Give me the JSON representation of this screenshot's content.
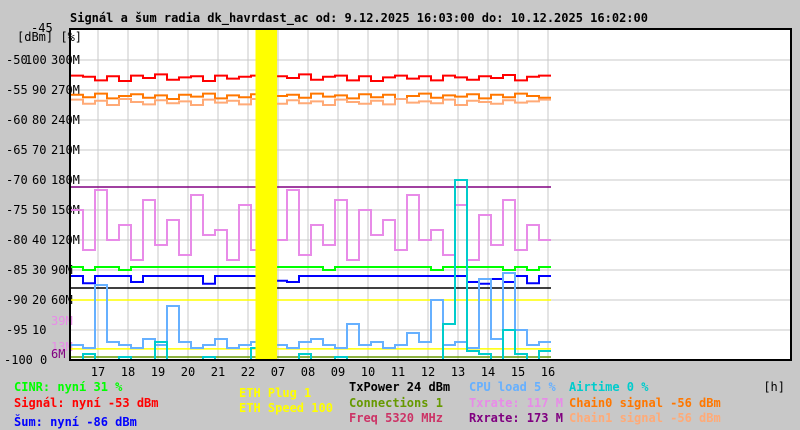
{
  "chart_data": {
    "type": "line",
    "title": "Signál a šum radia dk_havrdast_ac od: 9.12.2025 16:03:00 do: 10.12.2025 16:02:00",
    "xlabel": "[h]",
    "ylabel": "[dBm] [%]",
    "xlim": [
      0,
      24
    ],
    "ylim_dbm": [
      -100,
      -45
    ],
    "ylim_pct": [
      0,
      110
    ],
    "ylim_rate_M": [
      0,
      330
    ],
    "grid": true,
    "y_ticks_dbm": [
      "-45",
      "-50",
      "-55",
      "-60",
      "-65",
      "-70",
      "-75",
      "-80",
      "-85",
      "-90",
      "-95",
      "-100"
    ],
    "y_ticks_pct": [
      "100",
      "90",
      "80",
      "70",
      "60",
      "50",
      "40",
      "30",
      "20",
      "10",
      "0"
    ],
    "y_ticks_rate": [
      "300M",
      "270M",
      "240M",
      "210M",
      "180M",
      "150M",
      "120M",
      "90M",
      "60M"
    ],
    "rate_marks": [
      {
        "label": "39M",
        "value": 39,
        "color": "#e88be8"
      },
      {
        "label": "13M",
        "value": 13,
        "color": "#e88be8"
      },
      {
        "label": "6M",
        "value": 6,
        "color": "#800080"
      }
    ],
    "x_ticks": [
      "17",
      "18",
      "19",
      "20",
      "21",
      "22",
      "07",
      "08",
      "09",
      "10",
      "11",
      "12",
      "13",
      "14",
      "15",
      "16"
    ],
    "x_tick_start": 0.9,
    "sample_step_h": 0.4,
    "outage_h": [
      6.15,
      6.87
    ],
    "outage_color": "#ffff00",
    "series": [
      {
        "name": "Signál",
        "unit": "dBm",
        "color": "#ff0000",
        "values": [
          -52.6,
          -52.8,
          -53.4,
          -52.7,
          -53.5,
          -52.6,
          -53.0,
          -52.4,
          -53.3,
          -52.9,
          -52.7,
          -53.5,
          -52.6,
          -53.1,
          -52.8,
          -52.6,
          -53.4,
          -52.7,
          -53.0,
          -52.4,
          -53.3,
          -52.8,
          -52.6,
          -53.4,
          -52.7,
          -53.5,
          -52.9,
          -52.6,
          -53.1,
          -52.7,
          -53.4,
          -52.6,
          -52.9,
          -53.3,
          -52.7,
          -53.0,
          -52.5,
          -53.4,
          -52.8,
          -52.6
        ]
      },
      {
        "name": "Chain0 signal",
        "unit": "dBm",
        "color": "#ff7700",
        "values": [
          -55.8,
          -56.2,
          -55.6,
          -56.4,
          -56.0,
          -55.7,
          -56.3,
          -55.9,
          -56.5,
          -55.8,
          -56.1,
          -55.6,
          -56.4,
          -55.9,
          -56.2,
          -55.7,
          -56.5,
          -56.0,
          -55.8,
          -56.3,
          -55.6,
          -56.1,
          -55.9,
          -56.4,
          -55.7,
          -56.2,
          -55.8,
          -56.5,
          -56.0,
          -55.6,
          -56.3,
          -55.9,
          -56.1,
          -55.7,
          -56.4,
          -55.8,
          -56.2,
          -55.6,
          -56.0,
          -56.3
        ]
      },
      {
        "name": "Chain1 signal",
        "unit": "dBm",
        "color": "#ffaa77",
        "values": [
          -56.6,
          -57.3,
          -56.8,
          -57.5,
          -56.5,
          -57.0,
          -57.4,
          -56.7,
          -57.2,
          -56.9,
          -57.5,
          -56.6,
          -57.1,
          -56.8,
          -57.4,
          -56.5,
          -57.0,
          -57.3,
          -56.7,
          -57.2,
          -56.9,
          -57.5,
          -56.6,
          -57.0,
          -57.3,
          -56.8,
          -57.4,
          -56.5,
          -57.1,
          -56.9,
          -57.2,
          -56.6,
          -57.5,
          -56.8,
          -57.0,
          -57.3,
          -56.7,
          -57.1,
          -56.9,
          -56.6
        ]
      },
      {
        "name": "Txrate",
        "unit": "M",
        "color": "#e88be8",
        "values": [
          150,
          110,
          170,
          120,
          135,
          100,
          160,
          115,
          140,
          105,
          165,
          125,
          130,
          100,
          155,
          110,
          145,
          120,
          170,
          105,
          135,
          115,
          160,
          100,
          150,
          125,
          140,
          110,
          165,
          120,
          130,
          105,
          155,
          100,
          145,
          115,
          160,
          110,
          135,
          120
        ]
      },
      {
        "name": "Rxrate",
        "unit": "M",
        "color": "#800080",
        "values": [
          173,
          173,
          173,
          173,
          173,
          173,
          173,
          173,
          173,
          173,
          173,
          173,
          173,
          173,
          173,
          173,
          173,
          173,
          173,
          173,
          173,
          173,
          173,
          173,
          173,
          173,
          173,
          173,
          173,
          173,
          173,
          173,
          173,
          173,
          173,
          173,
          173,
          173,
          173,
          173
        ]
      },
      {
        "name": "CINR",
        "unit": "%",
        "color": "#00ff00",
        "values": [
          31,
          30,
          31,
          31,
          30,
          31,
          31,
          31,
          31,
          31,
          31,
          31,
          31,
          31,
          31,
          31,
          30,
          31,
          31,
          31,
          31,
          30,
          31,
          31,
          31,
          31,
          31,
          31,
          31,
          31,
          30,
          31,
          31,
          31,
          31,
          31,
          30,
          31,
          30,
          31
        ]
      },
      {
        "name": "Šum",
        "unit": "dBm",
        "color": "#0000ff",
        "values": [
          -86.0,
          -87.2,
          -86.0,
          -86.0,
          -86.0,
          -87.0,
          -86.0,
          -86.0,
          -86.0,
          -86.0,
          -86.0,
          -87.3,
          -86.0,
          -86.0,
          -86.0,
          -86.0,
          -86.0,
          -86.8,
          -87.0,
          -86.0,
          -86.0,
          -86.0,
          -86.0,
          -86.0,
          -86.0,
          -86.0,
          -86.0,
          -86.0,
          -86.0,
          -86.0,
          -86.0,
          -86.0,
          -86.0,
          -87.0,
          -87.3,
          -86.5,
          -87.0,
          -86.0,
          -87.2,
          -86.0
        ]
      },
      {
        "name": "TxPower",
        "unit": "%",
        "color": "#000000",
        "values": [
          24,
          24,
          24,
          24,
          24,
          24,
          24,
          24,
          24,
          24,
          24,
          24,
          24,
          24,
          24,
          24,
          24,
          24,
          24,
          24,
          24,
          24,
          24,
          24,
          24,
          24,
          24,
          24,
          24,
          24,
          24,
          24,
          24,
          24,
          24,
          24,
          24,
          24,
          24,
          24
        ]
      },
      {
        "name": "ETH Speed",
        "unit": "%",
        "color": "#ffff00",
        "values": [
          20,
          20,
          20,
          20,
          20,
          20,
          20,
          20,
          20,
          20,
          20,
          20,
          20,
          20,
          20,
          20,
          20,
          20,
          20,
          20,
          20,
          20,
          20,
          20,
          20,
          20,
          20,
          20,
          20,
          20,
          20,
          20,
          20,
          20,
          20,
          20,
          20,
          20,
          20,
          20
        ]
      },
      {
        "name": "ETH Plug",
        "unit": "%",
        "color": "#ffff00",
        "values": [
          3.7,
          3.7,
          3.7,
          3.7,
          3.7,
          3.7,
          3.7,
          3.7,
          3.7,
          3.7,
          3.7,
          3.7,
          3.7,
          3.7,
          3.7,
          3.7,
          3.7,
          3.7,
          3.7,
          3.7,
          3.7,
          3.7,
          3.7,
          3.7,
          3.7,
          3.7,
          3.7,
          3.7,
          3.7,
          3.7,
          3.7,
          3.7,
          3.7,
          3.7,
          3.7,
          3.7,
          3.7,
          3.7,
          3.7,
          3.7
        ]
      },
      {
        "name": "Connections",
        "unit": "%",
        "color": "#669900",
        "values": [
          1,
          1,
          1,
          1,
          1,
          1,
          1,
          1,
          1,
          1,
          1,
          1,
          1,
          1,
          1,
          1,
          1,
          1,
          1,
          1,
          1,
          1,
          1,
          1,
          1,
          1,
          1,
          1,
          1,
          1,
          1,
          1,
          1,
          1,
          1,
          1,
          1,
          1,
          1,
          1
        ]
      },
      {
        "name": "CPU load",
        "unit": "%",
        "color": "#66b0ff",
        "values": [
          5,
          4,
          25,
          6,
          5,
          4,
          7,
          5,
          18,
          6,
          4,
          5,
          7,
          4,
          5,
          6,
          100,
          5,
          4,
          6,
          7,
          5,
          4,
          12,
          5,
          6,
          4,
          5,
          9,
          6,
          20,
          5,
          6,
          4,
          27,
          7,
          29,
          10,
          5,
          6
        ]
      },
      {
        "name": "Airtime",
        "unit": "%",
        "color": "#00cccc",
        "values": [
          0,
          2,
          0,
          0,
          1,
          0,
          0,
          6,
          0,
          0,
          0,
          1,
          0,
          0,
          0,
          4,
          0,
          0,
          0,
          2,
          0,
          0,
          1,
          0,
          0,
          0,
          0,
          0,
          0,
          0,
          0,
          12,
          60,
          3,
          2,
          0,
          10,
          2,
          0,
          3
        ]
      }
    ]
  },
  "legend": {
    "cinr": "CINR: nyní 31 %",
    "signal": "Signál: nyní -53 dBm",
    "noise": "Šum: nyní -86 dBm",
    "eth_plug": "ETH Plug 1",
    "eth_speed": "ETH Speed 100",
    "txpower": "TxPower 24 dBm",
    "connections": "Connections 1",
    "freq": "Freq 5320 MHz",
    "cpu": "CPU load 5 %",
    "txrate": "Txrate: 117 M",
    "rxrate": "Rxrate: 173 M",
    "airtime": "Airtime 0 %",
    "chain0": "Chain0 signal -56 dBm",
    "chain1": "Chain1 signal -56 dBm"
  }
}
